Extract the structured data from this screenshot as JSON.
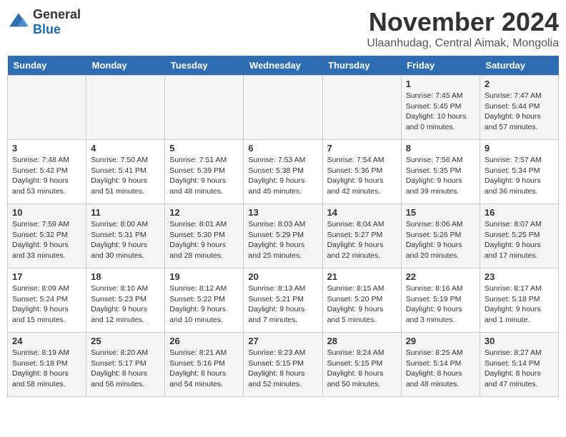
{
  "header": {
    "logo": {
      "general": "General",
      "blue": "Blue"
    },
    "title": "November 2024",
    "location": "Ulaanhudag, Central Aimak, Mongolia"
  },
  "calendar": {
    "weekdays": [
      "Sunday",
      "Monday",
      "Tuesday",
      "Wednesday",
      "Thursday",
      "Friday",
      "Saturday"
    ],
    "weeks": [
      [
        {
          "day": "",
          "info": ""
        },
        {
          "day": "",
          "info": ""
        },
        {
          "day": "",
          "info": ""
        },
        {
          "day": "",
          "info": ""
        },
        {
          "day": "",
          "info": ""
        },
        {
          "day": "1",
          "info": "Sunrise: 7:45 AM\nSunset: 5:45 PM\nDaylight: 10 hours and 0 minutes."
        },
        {
          "day": "2",
          "info": "Sunrise: 7:47 AM\nSunset: 5:44 PM\nDaylight: 9 hours and 57 minutes."
        }
      ],
      [
        {
          "day": "3",
          "info": "Sunrise: 7:48 AM\nSunset: 5:42 PM\nDaylight: 9 hours and 53 minutes."
        },
        {
          "day": "4",
          "info": "Sunrise: 7:50 AM\nSunset: 5:41 PM\nDaylight: 9 hours and 51 minutes."
        },
        {
          "day": "5",
          "info": "Sunrise: 7:51 AM\nSunset: 5:39 PM\nDaylight: 9 hours and 48 minutes."
        },
        {
          "day": "6",
          "info": "Sunrise: 7:53 AM\nSunset: 5:38 PM\nDaylight: 9 hours and 45 minutes."
        },
        {
          "day": "7",
          "info": "Sunrise: 7:54 AM\nSunset: 5:36 PM\nDaylight: 9 hours and 42 minutes."
        },
        {
          "day": "8",
          "info": "Sunrise: 7:56 AM\nSunset: 5:35 PM\nDaylight: 9 hours and 39 minutes."
        },
        {
          "day": "9",
          "info": "Sunrise: 7:57 AM\nSunset: 5:34 PM\nDaylight: 9 hours and 36 minutes."
        }
      ],
      [
        {
          "day": "10",
          "info": "Sunrise: 7:59 AM\nSunset: 5:32 PM\nDaylight: 9 hours and 33 minutes."
        },
        {
          "day": "11",
          "info": "Sunrise: 8:00 AM\nSunset: 5:31 PM\nDaylight: 9 hours and 30 minutes."
        },
        {
          "day": "12",
          "info": "Sunrise: 8:01 AM\nSunset: 5:30 PM\nDaylight: 9 hours and 28 minutes."
        },
        {
          "day": "13",
          "info": "Sunrise: 8:03 AM\nSunset: 5:29 PM\nDaylight: 9 hours and 25 minutes."
        },
        {
          "day": "14",
          "info": "Sunrise: 8:04 AM\nSunset: 5:27 PM\nDaylight: 9 hours and 22 minutes."
        },
        {
          "day": "15",
          "info": "Sunrise: 8:06 AM\nSunset: 5:26 PM\nDaylight: 9 hours and 20 minutes."
        },
        {
          "day": "16",
          "info": "Sunrise: 8:07 AM\nSunset: 5:25 PM\nDaylight: 9 hours and 17 minutes."
        }
      ],
      [
        {
          "day": "17",
          "info": "Sunrise: 8:09 AM\nSunset: 5:24 PM\nDaylight: 9 hours and 15 minutes."
        },
        {
          "day": "18",
          "info": "Sunrise: 8:10 AM\nSunset: 5:23 PM\nDaylight: 9 hours and 12 minutes."
        },
        {
          "day": "19",
          "info": "Sunrise: 8:12 AM\nSunset: 5:22 PM\nDaylight: 9 hours and 10 minutes."
        },
        {
          "day": "20",
          "info": "Sunrise: 8:13 AM\nSunset: 5:21 PM\nDaylight: 9 hours and 7 minutes."
        },
        {
          "day": "21",
          "info": "Sunrise: 8:15 AM\nSunset: 5:20 PM\nDaylight: 9 hours and 5 minutes."
        },
        {
          "day": "22",
          "info": "Sunrise: 8:16 AM\nSunset: 5:19 PM\nDaylight: 9 hours and 3 minutes."
        },
        {
          "day": "23",
          "info": "Sunrise: 8:17 AM\nSunset: 5:18 PM\nDaylight: 9 hours and 1 minute."
        }
      ],
      [
        {
          "day": "24",
          "info": "Sunrise: 8:19 AM\nSunset: 5:18 PM\nDaylight: 8 hours and 58 minutes."
        },
        {
          "day": "25",
          "info": "Sunrise: 8:20 AM\nSunset: 5:17 PM\nDaylight: 8 hours and 56 minutes."
        },
        {
          "day": "26",
          "info": "Sunrise: 8:21 AM\nSunset: 5:16 PM\nDaylight: 8 hours and 54 minutes."
        },
        {
          "day": "27",
          "info": "Sunrise: 8:23 AM\nSunset: 5:15 PM\nDaylight: 8 hours and 52 minutes."
        },
        {
          "day": "28",
          "info": "Sunrise: 8:24 AM\nSunset: 5:15 PM\nDaylight: 8 hours and 50 minutes."
        },
        {
          "day": "29",
          "info": "Sunrise: 8:25 AM\nSunset: 5:14 PM\nDaylight: 8 hours and 48 minutes."
        },
        {
          "day": "30",
          "info": "Sunrise: 8:27 AM\nSunset: 5:14 PM\nDaylight: 8 hours and 47 minutes."
        }
      ]
    ]
  }
}
